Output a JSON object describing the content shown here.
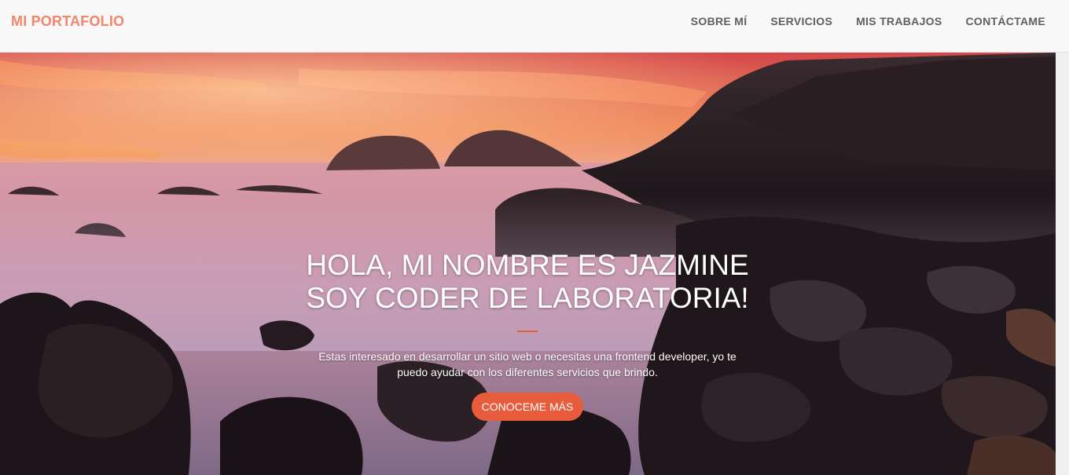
{
  "navbar": {
    "brand": "MI PORTAFOLIO",
    "items": [
      {
        "label": "SOBRE MÍ"
      },
      {
        "label": "SERVICIOS"
      },
      {
        "label": "MIS TRABAJOS"
      },
      {
        "label": "CONTÁCTAME"
      }
    ]
  },
  "hero": {
    "title_line1": "HOLA, MI NOMBRE ES JAZMINE",
    "title_line2": "SOY CODER DE LABORATORIA!",
    "text": "Estas interesado en desarrollar un sitio web o necesitas una frontend developer, yo te puedo ayudar con los diferentes servicios que brindo.",
    "button_label": "CONOCEME MÁS",
    "background_image": "sunset-rocky-coast-photo"
  },
  "colors": {
    "brand": "#f0866a",
    "accent": "#e85c3c",
    "nav_text": "#5f5f5f",
    "navbar_bg": "#f8f8f8"
  }
}
